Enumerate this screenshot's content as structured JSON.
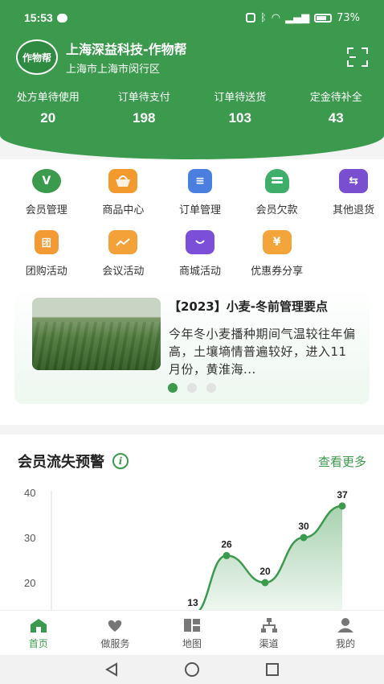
{
  "status": {
    "time": "15:53",
    "battery": "73%"
  },
  "brand": {
    "logo_text": "作物帮",
    "name": "上海深益科技-作物帮",
    "address": "上海市上海市闵行区"
  },
  "stats": [
    {
      "label": "处方单待使用",
      "value": "20"
    },
    {
      "label": "订单待支付",
      "value": "198"
    },
    {
      "label": "订单待送货",
      "value": "103"
    },
    {
      "label": "定金待补全",
      "value": "43"
    }
  ],
  "menu": [
    {
      "label": "会员管理",
      "icon": "vip-icon",
      "color": "#3c9a4e",
      "glyph": "V"
    },
    {
      "label": "商品中心",
      "icon": "basket-icon",
      "color": "#f29a2e",
      "glyph": ""
    },
    {
      "label": "订单管理",
      "icon": "clipboard-icon",
      "color": "#4a7fe0",
      "glyph": "≡"
    },
    {
      "label": "会员欠款",
      "icon": "coins-icon",
      "color": "#3fae6a",
      "glyph": ""
    },
    {
      "label": "其他退货",
      "icon": "return-box-icon",
      "color": "#7a4fcf",
      "glyph": "⇆"
    },
    {
      "label": "团购活动",
      "icon": "group-buy-icon",
      "color": "#f39a34",
      "glyph": "团"
    },
    {
      "label": "会议活动",
      "icon": "meeting-board-icon",
      "color": "#f3a23a",
      "glyph": ""
    },
    {
      "label": "商城活动",
      "icon": "mall-icon",
      "color": "#7b4fd8",
      "glyph": ""
    },
    {
      "label": "优惠券分享",
      "icon": "coupon-icon",
      "color": "#f3a43a",
      "glyph": "¥"
    }
  ],
  "banner": {
    "title": "【2023】小麦-冬前管理要点",
    "desc": "今年冬小麦播种期间气温较往年偏高，土壤墒情普遍较好，进入11月份，黄淮海..."
  },
  "warning": {
    "title": "会员流失预警",
    "more": "查看更多"
  },
  "chart_data": {
    "type": "area",
    "y_ticks": [
      "40",
      "30",
      "20"
    ],
    "ylim": [
      10,
      40
    ],
    "x": [
      1,
      2,
      3,
      4,
      5
    ],
    "values": [
      13,
      26,
      20,
      30,
      37
    ],
    "data_labels": [
      "13",
      "26",
      "20",
      "30",
      "37"
    ],
    "grid": false,
    "color": "#3c9a4e"
  },
  "tabs": [
    {
      "label": "首页",
      "icon": "home-icon",
      "active": true
    },
    {
      "label": "做服务",
      "icon": "service-heart-icon",
      "active": false
    },
    {
      "label": "地图",
      "icon": "map-icon",
      "active": false
    },
    {
      "label": "渠道",
      "icon": "channel-icon",
      "active": false
    },
    {
      "label": "我的",
      "icon": "user-icon",
      "active": false
    }
  ]
}
